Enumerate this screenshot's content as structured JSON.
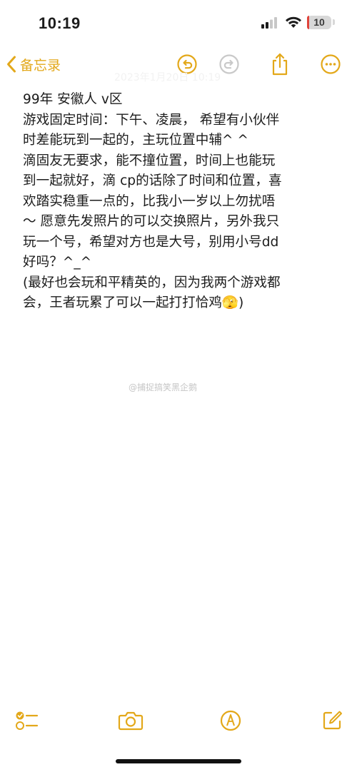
{
  "status_bar": {
    "time": "10:19",
    "battery_percent": "10",
    "battery_level": 0.1,
    "signal_icon": "cellular-signal-icon",
    "wifi_icon": "wifi-icon"
  },
  "nav": {
    "back_label": "备忘录",
    "back_icon": "chevron-left-icon",
    "faded_date": "2023年1月20日 10:19",
    "buttons": [
      "undo-icon",
      "redo-icon",
      "share-icon",
      "more-icon"
    ]
  },
  "note": {
    "lines": [
      "99年 安徽人 v区",
      "游戏固定时间：下午、凌晨， 希望有小伙伴",
      "时差能玩到一起的，主玩位置中辅^ ^",
      "滴固友无要求，能不撞位置，时间上也能玩",
      "到一起就好，滴 cp的话除了时间和位置，喜",
      "欢踏实稳重一点的，比我小一岁以上勿扰唔",
      "～ 愿意先发照片的可以交换照片，另外我只",
      "玩一个号，希望对方也是大号，别用小号dd",
      "好吗？^_^",
      "(最好也会玩和平精英的，因为我两个游戏都",
      "会，王者玩累了可以一起打打恰鸡🫣)"
    ]
  },
  "watermark": "@捕捉搞笑黑企鹅",
  "toolbar": {
    "buttons": [
      "checklist-icon",
      "camera-icon",
      "markup-pen-icon",
      "compose-icon"
    ]
  },
  "colors": {
    "accent": "#e3a81a",
    "text": "#1c1c1c",
    "battery_low": "#e0433a"
  }
}
